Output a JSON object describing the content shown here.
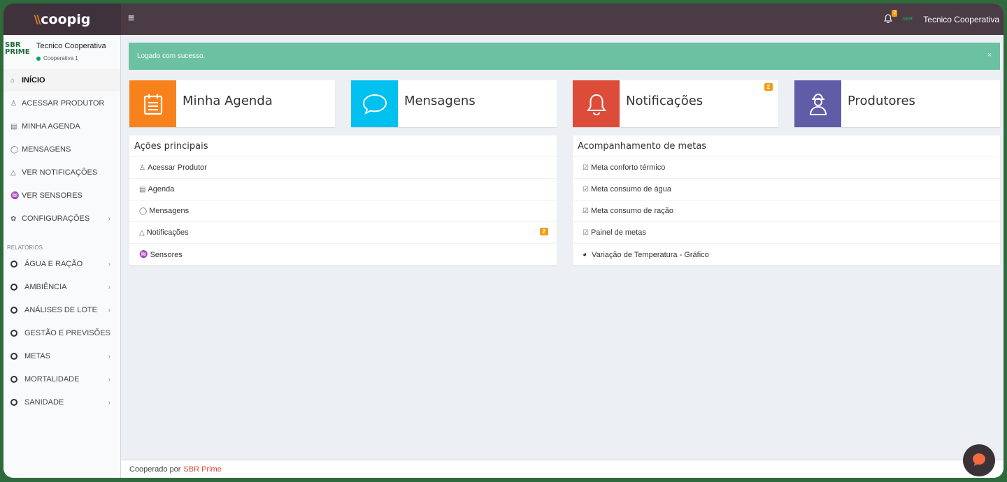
{
  "brand": {
    "logo_text": "coopig",
    "logo_prefix": "\\\\"
  },
  "topbar": {
    "menu_glyph": "≡",
    "notification_count": "2",
    "user_name": "Tecnico Cooperativa",
    "mini_logo_text": "SBR"
  },
  "sidebar": {
    "user_name": "Tecnico Cooperativa",
    "user_status": "Cooperativa 1",
    "logo_line1": "SBR",
    "logo_line2": "PRIME",
    "items": [
      {
        "label": "INÍCIO",
        "icon": "home-icon",
        "glyph": "⌂"
      },
      {
        "label": "ACESSAR PRODUTOR",
        "icon": "user-icon",
        "glyph": "♙"
      },
      {
        "label": "MINHA AGENDA",
        "icon": "calendar-icon",
        "glyph": "▤"
      },
      {
        "label": "MENSAGENS",
        "icon": "chat-icon",
        "glyph": "◯"
      },
      {
        "label": "VER NOTIFICAÇÕES",
        "icon": "bell-icon",
        "glyph": "△"
      },
      {
        "label": "VER SENSORES",
        "icon": "rss-icon",
        "glyph": "♒"
      },
      {
        "label": "CONFIGURAÇÕES",
        "icon": "gear-icon",
        "glyph": "✿"
      }
    ],
    "reports_header": "RELATÓRIOS",
    "reports": [
      {
        "label": "ÁGUA E RAÇÃO"
      },
      {
        "label": "AMBIÊNCIA"
      },
      {
        "label": "ANÁLISES DE LOTE"
      },
      {
        "label": "GESTÃO E PREVISÕES"
      },
      {
        "label": "METAS"
      },
      {
        "label": "MORTALIDADE"
      },
      {
        "label": "SANIDADE"
      }
    ]
  },
  "alert": {
    "message": "Logado com sucesso.",
    "close": "×"
  },
  "infoboxes": [
    {
      "label": "Minha Agenda",
      "color": "#f7821c",
      "icon": "calendar-icon"
    },
    {
      "label": "Mensagens",
      "color": "#00c0ef",
      "icon": "chat-icon"
    },
    {
      "label": "Notificações",
      "color": "#dd4b39",
      "icon": "bell-icon",
      "badge": "2"
    },
    {
      "label": "Produtores",
      "color": "#605ca8",
      "icon": "farmer-icon"
    }
  ],
  "actions_panel": {
    "title": "Ações principais",
    "rows": [
      {
        "label": "Acessar Produtor",
        "glyph": "♙"
      },
      {
        "label": "Agenda",
        "glyph": "▤"
      },
      {
        "label": "Mensagens",
        "glyph": "◯"
      },
      {
        "label": "Notificações",
        "glyph": "△",
        "badge": "2"
      },
      {
        "label": "Sensores",
        "glyph": "♒"
      }
    ]
  },
  "goals_panel": {
    "title": "Acompanhamento de metas",
    "rows": [
      {
        "label": "Meta conforto térmico",
        "glyph": "☑"
      },
      {
        "label": "Meta consumo de água",
        "glyph": "☑"
      },
      {
        "label": "Meta consumo de ração",
        "glyph": "☑"
      },
      {
        "label": "Painel de metas",
        "glyph": "☑"
      },
      {
        "label": "Variação de Temperatura - Gráfico",
        "glyph": "◕"
      }
    ]
  },
  "footer": {
    "text": "Cooperado por",
    "link": "SBR Prime"
  }
}
